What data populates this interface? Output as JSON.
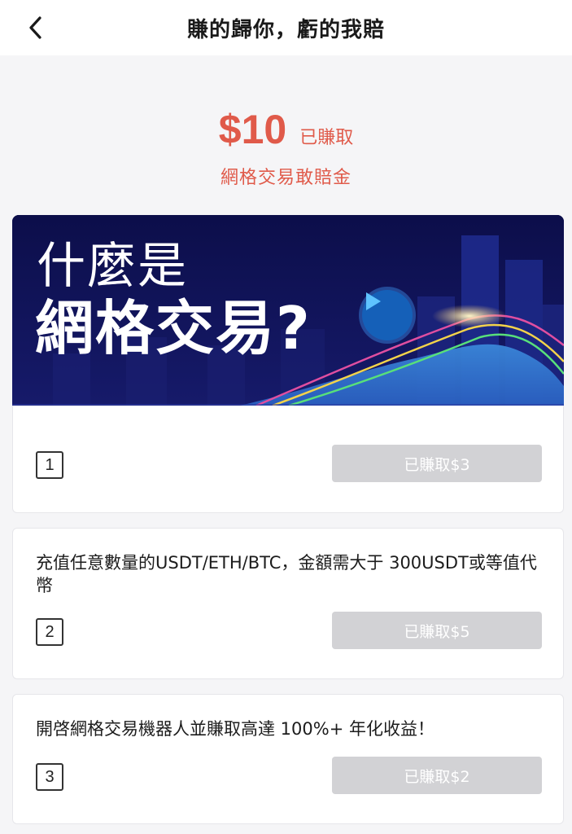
{
  "header": {
    "back_icon": "chevron-left-icon",
    "title": "賺的歸你，虧的我賠"
  },
  "reward": {
    "amount": "$10",
    "status": "已賺取",
    "fund_name": "網格交易敢賠金"
  },
  "banner": {
    "line1": "什麼是",
    "line2": "網格交易?",
    "play_icon": "play-icon"
  },
  "tasks": [
    {
      "number": "1",
      "text": "",
      "button_label": "已賺取$3"
    },
    {
      "number": "2",
      "text": "充值任意數量的USDT/ETH/BTC，金額需大于 300USDT或等值代幣",
      "button_label": "已賺取$5"
    },
    {
      "number": "3",
      "text": "開啓網格交易機器人並賺取高達 100%+ 年化收益！",
      "button_label": "已賺取$2"
    }
  ],
  "colors": {
    "accent": "#e05a4a",
    "banner_bg": "#0e1150",
    "button_disabled": "#d2d2d5"
  }
}
